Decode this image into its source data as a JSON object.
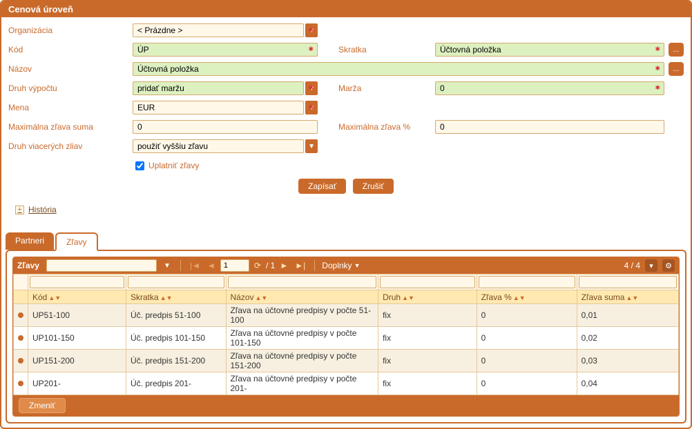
{
  "panel": {
    "title": "Cenová úroveň"
  },
  "form": {
    "org_label": "Organizácia",
    "org_value": "< Prázdne >",
    "kod_label": "Kód",
    "kod_value": "ÚP",
    "skratka_label": "Skratka",
    "skratka_value": "Účtovná položka",
    "nazov_label": "Názov",
    "nazov_value": "Účtovná položka",
    "druhvyp_label": "Druh výpočtu",
    "druhvyp_value": "pridať maržu",
    "marza_label": "Marža",
    "marza_value": "0",
    "mena_label": "Mena",
    "mena_value": "EUR",
    "maxsuma_label": "Maximálna zľava suma",
    "maxsuma_value": "0",
    "maxpct_label": "Maximálna zľava %",
    "maxpct_value": "0",
    "druhviac_label": "Druh viacerých zliav",
    "druhviac_value": "použiť vyššiu zľavu",
    "uplatnit_label": "Uplatniť zľavy",
    "uplatnit_checked": true,
    "save_label": "Zapísať",
    "cancel_label": "Zrušiť",
    "history_label": "História",
    "dots": "..."
  },
  "tabs": {
    "partneri": "Partneri",
    "zlavy": "Zľavy",
    "active": "zlavy"
  },
  "grid": {
    "title": "Zľavy",
    "page_current": "1",
    "page_total_prefix": "/",
    "page_total": "1",
    "doplnky_label": "Doplnky",
    "count_label": "4 / 4",
    "columns": {
      "kod": "Kód",
      "skratka": "Skratka",
      "nazov": "Názov",
      "druh": "Druh",
      "zlava_pct": "Zľava %",
      "zlava_suma": "Zľava suma"
    },
    "rows": [
      {
        "kod": "UP51-100",
        "skratka": "Úč. predpis 51-100",
        "nazov": "Zľava na účtovné predpisy v počte 51-100",
        "druh": "fix",
        "pct": "0",
        "suma": "0,01"
      },
      {
        "kod": "UP101-150",
        "skratka": "Úč. predpis 101-150",
        "nazov": "Zľava na účtovné predpisy v počte 101-150",
        "druh": "fix",
        "pct": "0",
        "suma": "0,02"
      },
      {
        "kod": "UP151-200",
        "skratka": "Úč. predpis 151-200",
        "nazov": "Zľava na účtovné predpisy v počte 151-200",
        "druh": "fix",
        "pct": "0",
        "suma": "0,03"
      },
      {
        "kod": "UP201-",
        "skratka": "Úč. predpis 201-",
        "nazov": "Zľava na účtovné predpisy v počte 201-",
        "druh": "fix",
        "pct": "0",
        "suma": "0,04"
      }
    ],
    "edit_label": "Zmeniť"
  }
}
